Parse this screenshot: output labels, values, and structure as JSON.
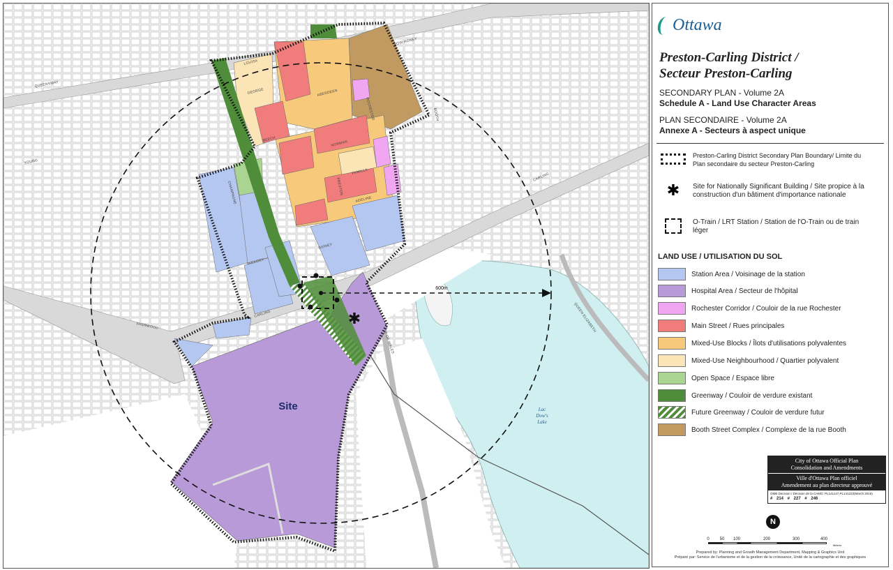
{
  "map": {
    "site_label": "Site",
    "lake_label_1": "Lac",
    "lake_label_2": "Dow's",
    "lake_label_3": "Lake",
    "distance_label": "600m",
    "streets": {
      "queensway": "QUEENSWAY",
      "beech": "BEECH",
      "carling": "CARLING",
      "aberdeen": "ABERDEEN",
      "norman": "NORMAN",
      "pamilla": "PAMILLA",
      "adeline": "ADELINE",
      "hickory": "HICKORY",
      "sidney": "SIDNEY",
      "champagne": "CHAMPAGNE",
      "rochester": "ROCHESTER",
      "preston": "PRESTON",
      "booth": "BOOTH",
      "dow_honey": "DOW HONEY",
      "prince_of_wales": "PRINCE OF WALES",
      "sherwood": "SHERWOOD",
      "carling_east": "CARLING",
      "queen_elizabeth": "QUEEN ELIZABETH",
      "young": "YOUNG",
      "george": "GEORGE",
      "louisa": "LOUISA"
    },
    "colors": {
      "station_area": "#b3c7f0",
      "hospital_area": "#b89ad8",
      "rochester_corridor": "#f0a6f0",
      "main_street": "#f07c7c",
      "mixed_use_blocks": "#f7c97a",
      "mixed_use_neighbourhood": "#fbe4b5",
      "open_space": "#a9d492",
      "greenway": "#4f8d3a",
      "booth_complex": "#c19a62",
      "water": "#cfeff0"
    }
  },
  "panel": {
    "logo_text": "Ottawa",
    "title_line1": "Preston-Carling District /",
    "title_line2": "Secteur Preston-Carling",
    "secondary_plan": "SECONDARY PLAN - Volume 2A",
    "schedule": "Schedule A - Land Use Character Areas",
    "plan_secondaire": "PLAN SECONDAIRE - Volume 2A",
    "annexe": "Annexe A - Secteurs à aspect unique",
    "legend": {
      "boundary": "Preston-Carling District Secondary Plan Boundary/ Limite du Plan secondaire du secteur Preston-Carling",
      "site_nsb": "Site for Nationally Significant Building / Site propice à la construction d'un bâtiment d'importance nationale",
      "station": "O-Train / LRT Station / Station de l'O-Train ou de train léger"
    },
    "land_use_title": "LAND USE / UTILISATION DU SOL",
    "land_use": [
      {
        "label": "Station Area / Voisinage de la station",
        "color": "#b3c7f0"
      },
      {
        "label": "Hospital Area / Secteur de l'hôpital",
        "color": "#b89ad8"
      },
      {
        "label": "Rochester Corridor / Couloir de la rue Rochester",
        "color": "#f0a6f0"
      },
      {
        "label": "Main Street / Rues principales",
        "color": "#f07c7c"
      },
      {
        "label": "Mixed-Use Blocks / Îlots d'utilisations polyvalentes",
        "color": "#f7c97a"
      },
      {
        "label": "Mixed-Use Neighbourhood / Quartier polyvalent",
        "color": "#fbe4b5"
      },
      {
        "label": "Open Space / Espace libre",
        "color": "#a9d492"
      },
      {
        "label": "Greenway / Couloir de verdure existant",
        "color": "#4f8d3a"
      },
      {
        "label": "Future Greenway / Couloir de verdure futur",
        "color": "hatch"
      },
      {
        "label": "Booth Street Complex / Complexe de la rue Booth",
        "color": "#c19a62"
      }
    ],
    "official_plan": {
      "line1": "City of Ottawa Official Plan",
      "line2": "Consolidation and Amendments",
      "line3": "Ville d'Ottawa Plan officiel",
      "line4": "Amendement au plan directeur approuvé",
      "decision": "OMB Decision / Décision de la CAMO: PL141147,PL141223(March 2016)",
      "ids": "# 214   # 227   # 246"
    },
    "north_arrow": "N",
    "scale": {
      "ticks": [
        "0",
        "50",
        "100",
        "200",
        "300",
        "400"
      ],
      "unit": "Meters"
    },
    "credits_line1": "Prepared by: Planning and Growth Management Department, Mapping & Graphics Unit",
    "credits_line2": "Préparé par: Service de l'urbanisme et de la gestion de la croissance, Unité de la cartographie et des graphiques"
  }
}
